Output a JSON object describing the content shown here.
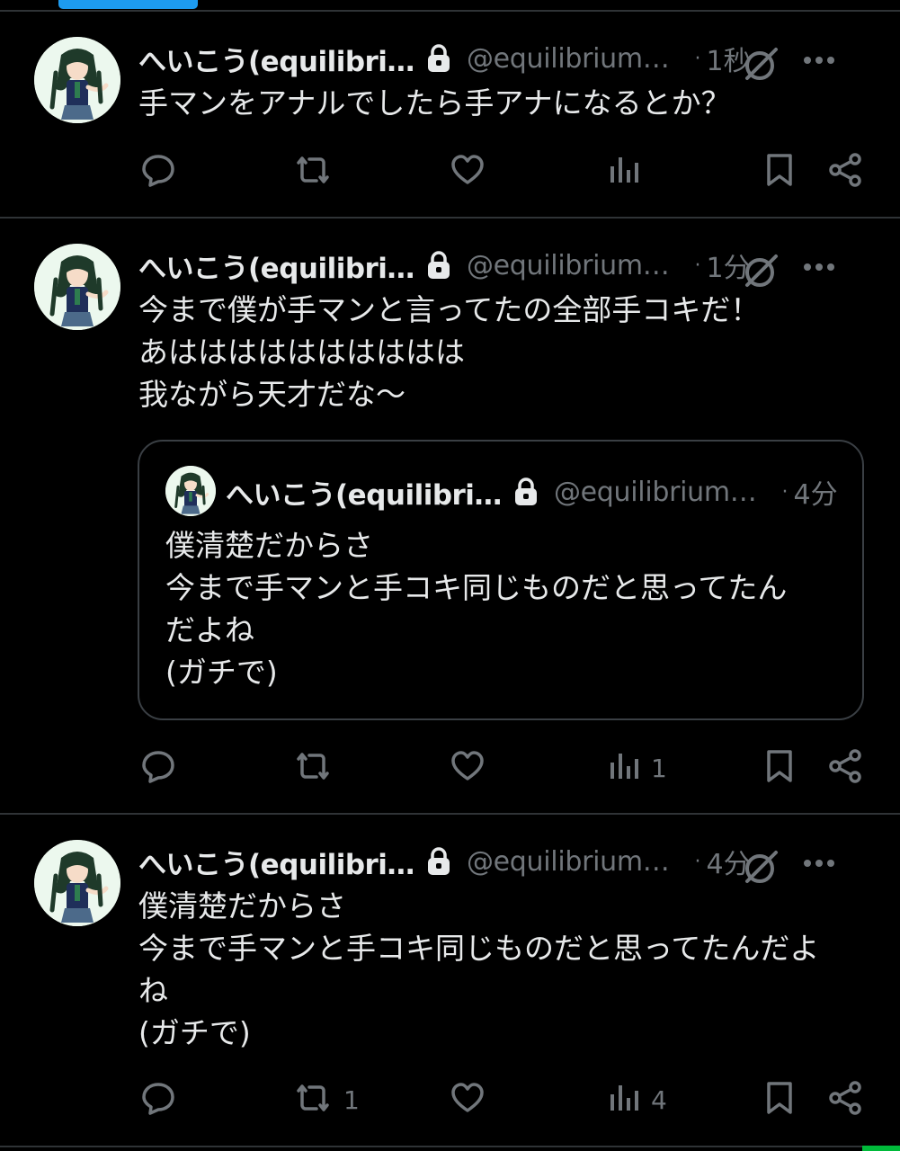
{
  "colors": {
    "background": "#000000",
    "text": "#e7e9ea",
    "muted": "#71767b",
    "accent": "#1d9bf0",
    "divider": "#2f3336"
  },
  "posts": [
    {
      "name": "へいこう(equilibri…",
      "handle": "@equilibrium…",
      "dot": "·",
      "time": "1秒",
      "text": "手マンをアナルでしたら手アナになるとか？",
      "actions": {
        "reply": "",
        "repost": "",
        "like": "",
        "views": ""
      }
    },
    {
      "name": "へいこう(equilibri…",
      "handle": "@equilibrium…",
      "dot": "·",
      "time": "1分",
      "text": "今まで僕が手マンと言ってたの全部手コキだ！\nあはははははははははは\n我ながら天才だな〜",
      "quote": {
        "name": "へいこう(equilibri…",
        "handle": "@equilibrium…",
        "dot": "·",
        "time": "4分",
        "text": "僕清楚だからさ\n今まで手マンと手コキ同じものだと思ってたん\nだよね\n(ガチで)"
      },
      "actions": {
        "reply": "",
        "repost": "",
        "like": "",
        "views": "1"
      }
    },
    {
      "name": "へいこう(equilibri…",
      "handle": "@equilibrium…",
      "dot": "·",
      "time": "4分",
      "text": "僕清楚だからさ\n今まで手マンと手コキ同じものだと思ってたんだよ\nね\n(ガチで)",
      "actions": {
        "reply": "",
        "repost": "1",
        "like": "",
        "views": "4"
      }
    }
  ],
  "icons": {
    "lock": "lock-icon",
    "grok": "grok-icon",
    "more": "more-icon",
    "reply": "reply-icon",
    "repost": "repost-icon",
    "like": "heart-icon",
    "views": "views-icon",
    "bookmark": "bookmark-icon",
    "share": "share-icon"
  }
}
